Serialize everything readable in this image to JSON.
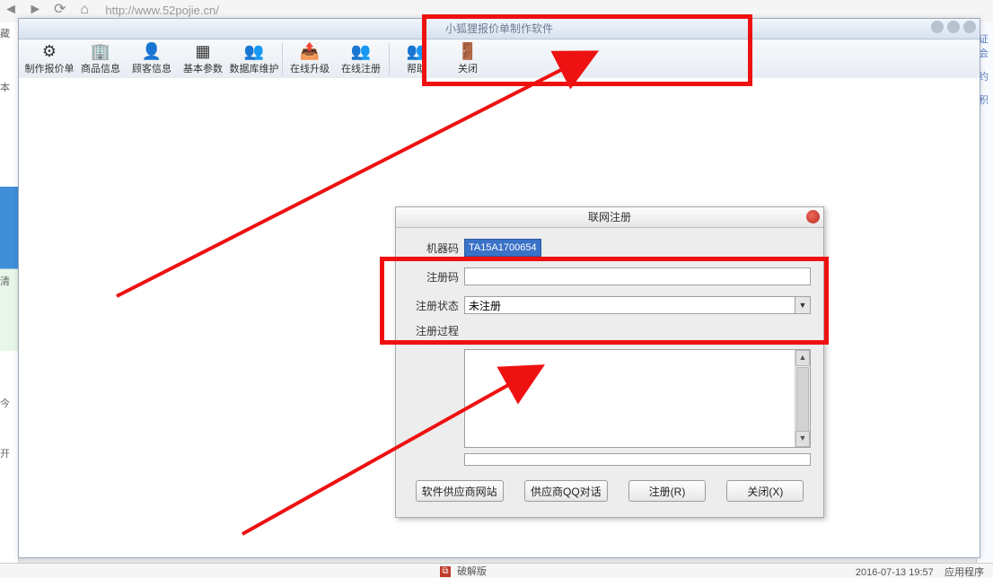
{
  "browser": {
    "url": "http://www.52pojie.cn/"
  },
  "window": {
    "title": "小狐狸报价单制作软件"
  },
  "toolbar": {
    "items": [
      {
        "label": "制作报价单",
        "icon": "⚙"
      },
      {
        "label": "商品信息",
        "icon": "🏢"
      },
      {
        "label": "顾客信息",
        "icon": "👤"
      },
      {
        "label": "基本参数",
        "icon": "▦"
      },
      {
        "label": "数据库维护",
        "icon": "👥"
      },
      {
        "label": "在线升级",
        "icon": "📤"
      },
      {
        "label": "在线注册",
        "icon": "👥"
      },
      {
        "label": "帮助",
        "icon": "👥"
      },
      {
        "label": "关闭",
        "icon": "🚪"
      }
    ]
  },
  "dialog": {
    "title": "联网注册",
    "fields": {
      "machine_label": "机器码",
      "machine_value": "TA15A1700654",
      "regcode_label": "注册码",
      "regcode_value": "",
      "status_label": "注册状态",
      "status_value": "未注册",
      "process_label": "注册过程"
    },
    "buttons": {
      "site": "软件供应商网站",
      "qq": "供应商QQ对话",
      "reg": "注册(R)",
      "close": "关闭(X)"
    }
  },
  "right_sliver": {
    "t1": "证会",
    "t2": "约",
    "t3": "积"
  },
  "left_sliver": {
    "t1": "藏",
    "t2": "本",
    "t3": "清",
    "t4": "今",
    "t5": "开"
  },
  "taskbar": {
    "mid_icon": "⧉",
    "mid_text": "破解版",
    "time": "2016-07-13 19:57",
    "type": "应用程序"
  }
}
